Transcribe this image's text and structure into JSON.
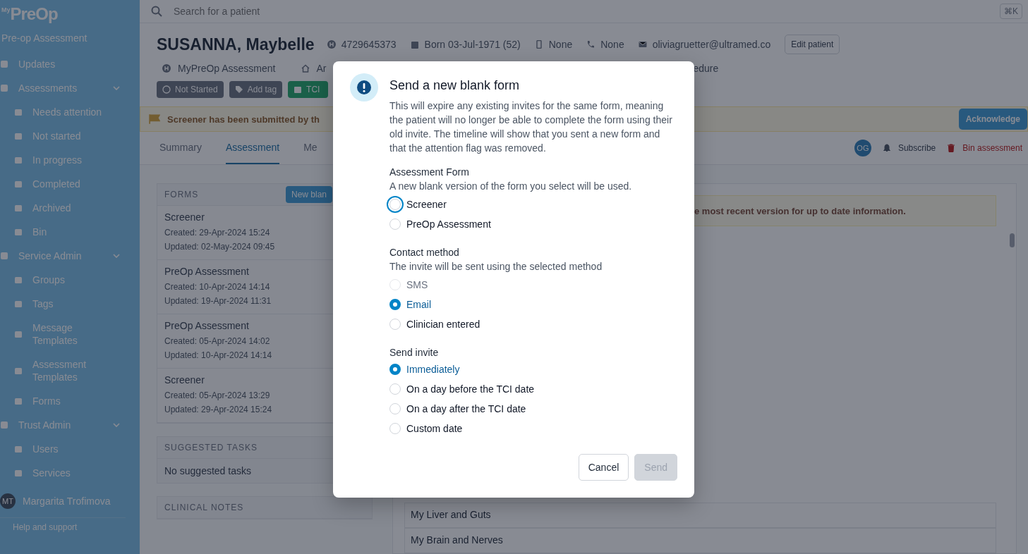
{
  "sidebar": {
    "logo": {
      "prefix": "My",
      "name": "PreOp"
    },
    "subtitle": "Pre-op Assessment",
    "items": [
      {
        "label": "Updates"
      },
      {
        "label": "Assessments",
        "expanded": true,
        "children": [
          {
            "label": "Needs attention"
          },
          {
            "label": "Not started"
          },
          {
            "label": "In progress"
          },
          {
            "label": "Completed"
          },
          {
            "label": "Archived"
          },
          {
            "label": "Bin"
          }
        ]
      },
      {
        "label": "Service Admin",
        "expanded": true,
        "children": [
          {
            "label": "Groups"
          },
          {
            "label": "Tags"
          },
          {
            "label": "Message Templates"
          },
          {
            "label": "Assessment Templates"
          },
          {
            "label": "Forms"
          }
        ]
      },
      {
        "label": "Trust Admin",
        "expanded": true,
        "children": [
          {
            "label": "Users"
          },
          {
            "label": "Services"
          }
        ]
      }
    ],
    "user": {
      "initials": "MT",
      "name": "Margarita Trofimova"
    },
    "help": "Help and support"
  },
  "search": {
    "placeholder": "Search for a patient",
    "shortcut": "⌘K"
  },
  "patient": {
    "name": "SUSANNA, Maybelle",
    "nhs_number": "4729645373",
    "born": "Born 03-Jul-1971 (52)",
    "mobile": "None",
    "phone": "None",
    "email": "oliviagruetter@ultramed.co",
    "edit_button": "Edit patient"
  },
  "patient_links": [
    {
      "label": "MyPreOp Assessment",
      "kind": "hospital"
    },
    {
      "label": "Ar",
      "kind": "home"
    },
    {
      "label": "edure",
      "kind": "text"
    }
  ],
  "tags": [
    {
      "label": "Not Started",
      "kind": "status"
    },
    {
      "label": "Add tag",
      "kind": "add"
    },
    {
      "label": "TCI",
      "kind": "tci"
    }
  ],
  "alert": {
    "text": "Screener has been submitted by th",
    "button": "Acknowledge"
  },
  "tabs": [
    {
      "label": "Summary",
      "selected": false
    },
    {
      "label": "Assessment",
      "selected": true
    },
    {
      "label": "Me",
      "selected": false
    }
  ],
  "actions": {
    "avatar": "OG",
    "subscribe": "Subscribe",
    "bin": "Bin assessment"
  },
  "forms_panel": {
    "heading": "FORMS",
    "new_button": "New blan",
    "items": [
      {
        "title": "Screener",
        "created": "Created: 29-Apr-2024 15:24",
        "updated": "Updated: 02-May-2024 09:45"
      },
      {
        "title": "PreOp Assessment",
        "created": "Created: 10-Apr-2024 14:14",
        "updated": "Updated: 19-Apr-2024 11:31"
      },
      {
        "title": "PreOp Assessment",
        "created": "Created: 05-Apr-2024 14:02",
        "updated": "Updated: 10-Apr-2024 14:14"
      },
      {
        "title": "Screener",
        "created": "Created: 05-Apr-2024 13:29",
        "updated": "Updated: 29-Apr-2024 15:24"
      }
    ]
  },
  "suggested_tasks": {
    "heading": "SUGGESTED TASKS",
    "empty": "No suggested tasks"
  },
  "clinical_notes": {
    "heading": "CLINICAL NOTES"
  },
  "assessment_panel": {
    "notice": "e most recent version for up to date information.",
    "sections": [
      "My Liver and Guts",
      "My Brain and Nerves"
    ]
  },
  "modal": {
    "title": "Send a new blank form",
    "body": "This will expire any existing invites for the same form, meaning the patient will no longer be able to complete the form using their old invite. The timeline will show that you sent a new form and that the attention flag was removed.",
    "groups": [
      {
        "label": "Assessment Form",
        "hint": "A new blank version of the form you select will be used.",
        "options": [
          {
            "label": "Screener",
            "selected": false,
            "disabled": false,
            "focused": true
          },
          {
            "label": "PreOp Assessment",
            "selected": false,
            "disabled": false,
            "focused": false
          }
        ]
      },
      {
        "label": "Contact method",
        "hint": "The invite will be sent using the selected method",
        "options": [
          {
            "label": "SMS",
            "selected": false,
            "disabled": true,
            "focused": false
          },
          {
            "label": "Email",
            "selected": true,
            "disabled": false,
            "focused": false
          },
          {
            "label": "Clinician entered",
            "selected": false,
            "disabled": false,
            "focused": false
          }
        ]
      },
      {
        "label": "Send invite",
        "options": [
          {
            "label": "Immediately",
            "selected": true,
            "disabled": false,
            "focused": false
          },
          {
            "label": "On a day before the TCI date",
            "selected": false,
            "disabled": false,
            "focused": false
          },
          {
            "label": "On a day after the TCI date",
            "selected": false,
            "disabled": false,
            "focused": false
          },
          {
            "label": "Custom date",
            "selected": false,
            "disabled": false,
            "focused": false
          }
        ]
      }
    ],
    "buttons": [
      {
        "label": "Cancel",
        "kind": "secondary",
        "disabled": false
      },
      {
        "label": "Send",
        "kind": "primary",
        "disabled": true
      }
    ]
  }
}
